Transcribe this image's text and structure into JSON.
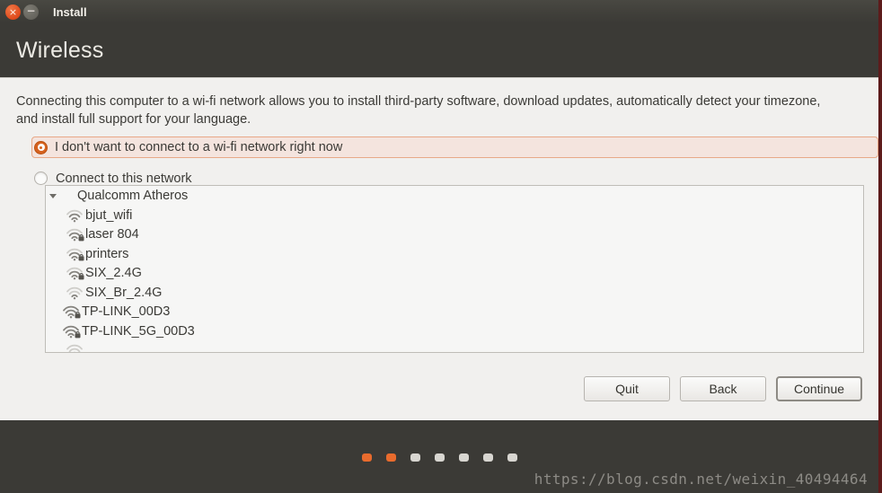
{
  "window": {
    "title": "Install",
    "close_glyph": "×",
    "minimize_glyph": "−",
    "accent_color": "#e96b2d",
    "titlebar_color": "#3b3a36",
    "content_color": "#f1f0ee"
  },
  "page": {
    "heading": "Wireless",
    "intro": "Connecting this computer to a wi-fi network allows you to install third-party software, download updates, automatically detect your timezone, and install full support for your language."
  },
  "options": {
    "no_connect_label": "I don't want to connect to a wi-fi network right now",
    "connect_label": "Connect to this network",
    "selected": "no_connect"
  },
  "network_list": {
    "group_label": "Qualcomm Atheros",
    "expanded": true,
    "networks": [
      {
        "name": "bjut_wifi",
        "secured": false,
        "strength": 2
      },
      {
        "name": "laser 804",
        "secured": true,
        "strength": 2
      },
      {
        "name": "printers",
        "secured": true,
        "strength": 2
      },
      {
        "name": "SIX_2.4G",
        "secured": true,
        "strength": 2
      },
      {
        "name": "SIX_Br_2.4G",
        "secured": false,
        "strength": 1
      },
      {
        "name": "TP-LINK_00D3",
        "secured": true,
        "strength": 3
      },
      {
        "name": "TP-LINK_5G_00D3",
        "secured": true,
        "strength": 3
      },
      {
        "name": "",
        "secured": false,
        "strength": 1
      }
    ]
  },
  "buttons": {
    "quit": "Quit",
    "back": "Back",
    "continue": "Continue",
    "focused": "continue"
  },
  "progress": {
    "total_steps": 7,
    "completed_steps": 2
  },
  "watermark": "https://blog.csdn.net/weixin_40494464"
}
